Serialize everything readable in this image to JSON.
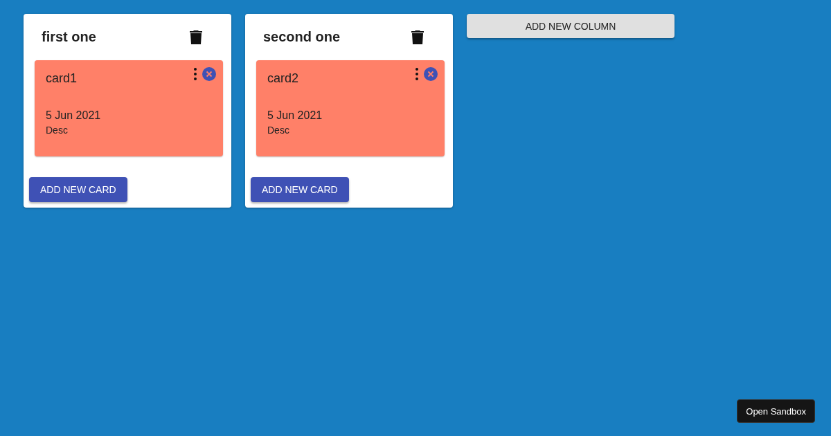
{
  "columns": [
    {
      "title": "first one",
      "cards": [
        {
          "title": "card1",
          "date": "5 Jun 2021",
          "description": "Desc"
        }
      ],
      "add_button": "ADD NEW CARD"
    },
    {
      "title": "second one",
      "cards": [
        {
          "title": "card2",
          "date": "5 Jun 2021",
          "description": "Desc"
        }
      ],
      "add_button": "ADD NEW CARD"
    }
  ],
  "add_column_button": "ADD NEW COLUMN",
  "sandbox_button": "Open Sandbox"
}
